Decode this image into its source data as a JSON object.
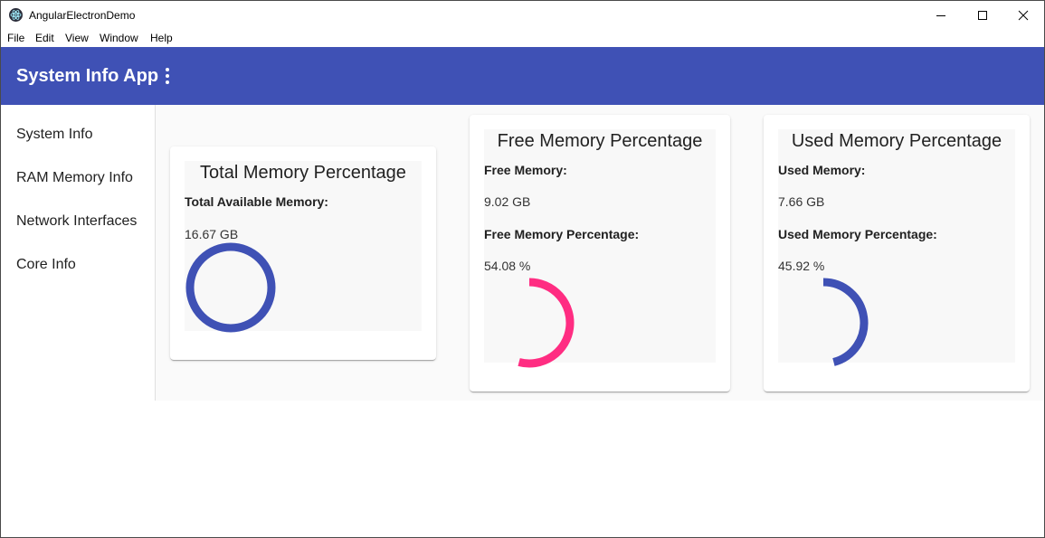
{
  "window": {
    "title": "AngularElectronDemo",
    "icon": "electron-app-icon"
  },
  "menu": [
    "File",
    "Edit",
    "View",
    "Window",
    "Help"
  ],
  "toolbar": {
    "title": "System Info App",
    "color": "#3f51b5"
  },
  "sidebar": {
    "items": [
      {
        "label": "System Info"
      },
      {
        "label": "RAM Memory Info"
      },
      {
        "label": "Network Interfaces"
      },
      {
        "label": "Core Info"
      }
    ]
  },
  "cards": {
    "total": {
      "title": "Total Memory Percentage",
      "label": "Total Available Memory:",
      "value": "16.67 GB",
      "percent": 100,
      "color": "#3f51b5"
    },
    "free": {
      "title": "Free Memory Percentage",
      "label": "Free Memory:",
      "value": "9.02 GB",
      "pct_label": "Free Memory Percentage:",
      "pct_value": "54.08 %",
      "percent": 54.08,
      "color": "#ff2d82"
    },
    "used": {
      "title": "Used Memory Percentage",
      "label": "Used Memory:",
      "value": "7.66 GB",
      "pct_label": "Used Memory Percentage:",
      "pct_value": "45.92 %",
      "percent": 45.92,
      "color": "#3f51b5"
    }
  }
}
